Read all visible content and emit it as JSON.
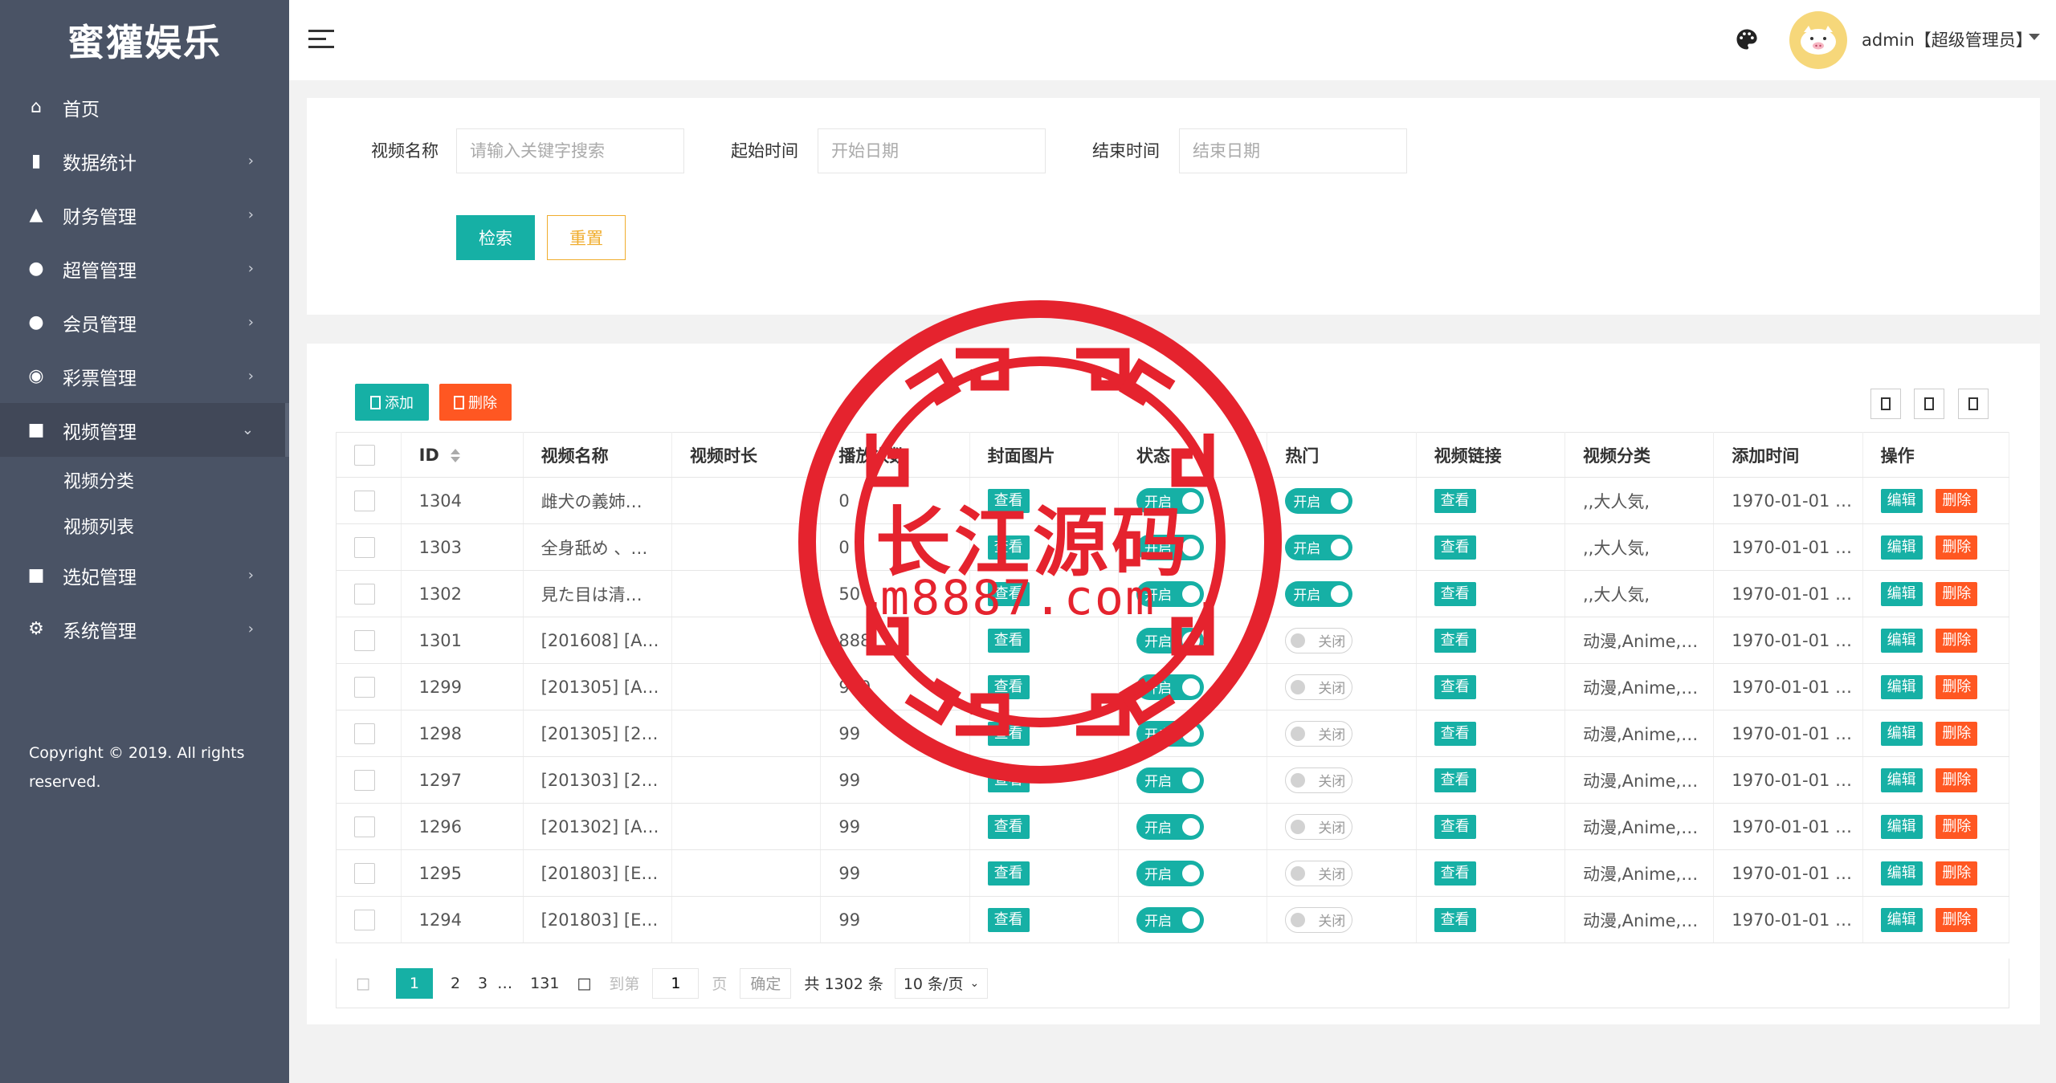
{
  "sidebar": {
    "logo": "蜜獾娱乐",
    "items": [
      {
        "label": "首页",
        "icon": "home-icon",
        "has_arrow": false
      },
      {
        "label": "数据统计",
        "icon": "bar-chart-icon",
        "has_arrow": true
      },
      {
        "label": "财务管理",
        "icon": "bank-icon",
        "has_arrow": true
      },
      {
        "label": "超管管理",
        "icon": "user-icon",
        "has_arrow": true
      },
      {
        "label": "会员管理",
        "icon": "users-icon",
        "has_arrow": true
      },
      {
        "label": "彩票管理",
        "icon": "gamepad-icon",
        "has_arrow": true
      },
      {
        "label": "视频管理",
        "icon": "video-icon",
        "has_arrow": true,
        "expanded": true
      },
      {
        "label": "选妃管理",
        "icon": "video-icon",
        "has_arrow": true
      },
      {
        "label": "系统管理",
        "icon": "gear-icon",
        "has_arrow": true
      }
    ],
    "submenu": [
      "视频分类",
      "视频列表"
    ],
    "copyright": "Copyright © 2019. All rights reserved."
  },
  "header": {
    "user_label": "admin【超级管理员】",
    "menu_icon": "hamburger-icon",
    "theme_icon": "palette-icon",
    "avatar_icon": "pig-avatar"
  },
  "search": {
    "name_label": "视频名称",
    "name_placeholder": "请输入关键字搜索",
    "start_label": "起始时间",
    "start_placeholder": "开始日期",
    "end_label": "结束时间",
    "end_placeholder": "结束日期",
    "search_button": "检索",
    "reset_button": "重置"
  },
  "toolbar": {
    "add_label": "添加",
    "delete_label": "删除"
  },
  "table": {
    "columns": [
      "ID",
      "视频名称",
      "视频时长",
      "播放次数",
      "封面图片",
      "状态",
      "热门",
      "视频链接",
      "视频分类",
      "添加时间",
      "操作"
    ],
    "view_label": "查看",
    "edit_label": "编辑",
    "delete_label": "删除",
    "on_label": "开启",
    "off_label": "关闭",
    "rows": [
      {
        "id": "1304",
        "name": "雌犬の義姉…",
        "duration": "",
        "plays": "0",
        "status": "开启",
        "hot": "开启",
        "hot_on": true,
        "category": ",,大人気,",
        "time": "1970-01-01 …"
      },
      {
        "id": "1303",
        "name": "全身舐め 、…",
        "duration": "",
        "plays": "0",
        "status": "开启",
        "hot": "开启",
        "hot_on": true,
        "category": ",,大人気,",
        "time": "1970-01-01 …"
      },
      {
        "id": "1302",
        "name": "見た目は清…",
        "duration": "",
        "plays": "50",
        "status": "开启",
        "hot": "开启",
        "hot_on": true,
        "category": ",,大人気,",
        "time": "1970-01-01 …"
      },
      {
        "id": "1301",
        "name": "[201608] [A…",
        "duration": "",
        "plays": "888",
        "status": "开启",
        "hot": "关闭",
        "hot_on": false,
        "category": "动漫,Anime,…",
        "time": "1970-01-01 …"
      },
      {
        "id": "1299",
        "name": "[201305] [A…",
        "duration": "",
        "plays": "999",
        "status": "开启",
        "hot": "关闭",
        "hot_on": false,
        "category": "动漫,Anime,…",
        "time": "1970-01-01 …"
      },
      {
        "id": "1298",
        "name": "[201305] [2…",
        "duration": "",
        "plays": "99",
        "status": "开启",
        "hot": "关闭",
        "hot_on": false,
        "category": "动漫,Anime,…",
        "time": "1970-01-01 …"
      },
      {
        "id": "1297",
        "name": "[201303] [2…",
        "duration": "",
        "plays": "99",
        "status": "开启",
        "hot": "关闭",
        "hot_on": false,
        "category": "动漫,Anime,…",
        "time": "1970-01-01 …"
      },
      {
        "id": "1296",
        "name": "[201302] [A…",
        "duration": "",
        "plays": "99",
        "status": "开启",
        "hot": "关闭",
        "hot_on": false,
        "category": "动漫,Anime,…",
        "time": "1970-01-01 …"
      },
      {
        "id": "1295",
        "name": "[201803] [E…",
        "duration": "",
        "plays": "99",
        "status": "开启",
        "hot": "关闭",
        "hot_on": false,
        "category": "动漫,Anime,…",
        "time": "1970-01-01 …"
      },
      {
        "id": "1294",
        "name": "[201803] [E…",
        "duration": "",
        "plays": "99",
        "status": "开启",
        "hot": "关闭",
        "hot_on": false,
        "category": "动漫,Anime,…",
        "time": "1970-01-01 …"
      }
    ]
  },
  "pagination": {
    "pages": [
      "1",
      "2",
      "3",
      "…",
      "131"
    ],
    "current": "1",
    "goto_label": "到第",
    "goto_value": "1",
    "page_unit": "页",
    "confirm": "确定",
    "total": "共 1302 条",
    "per_page": "10 条/页"
  },
  "watermark": {
    "text": "长江源码",
    "url": "m8887.com",
    "color": "#e5232e"
  },
  "colors": {
    "sidebar_bg": "#4a5365",
    "primary": "#16b0a5",
    "danger": "#ff5722",
    "warning": "#f0ad2e"
  }
}
